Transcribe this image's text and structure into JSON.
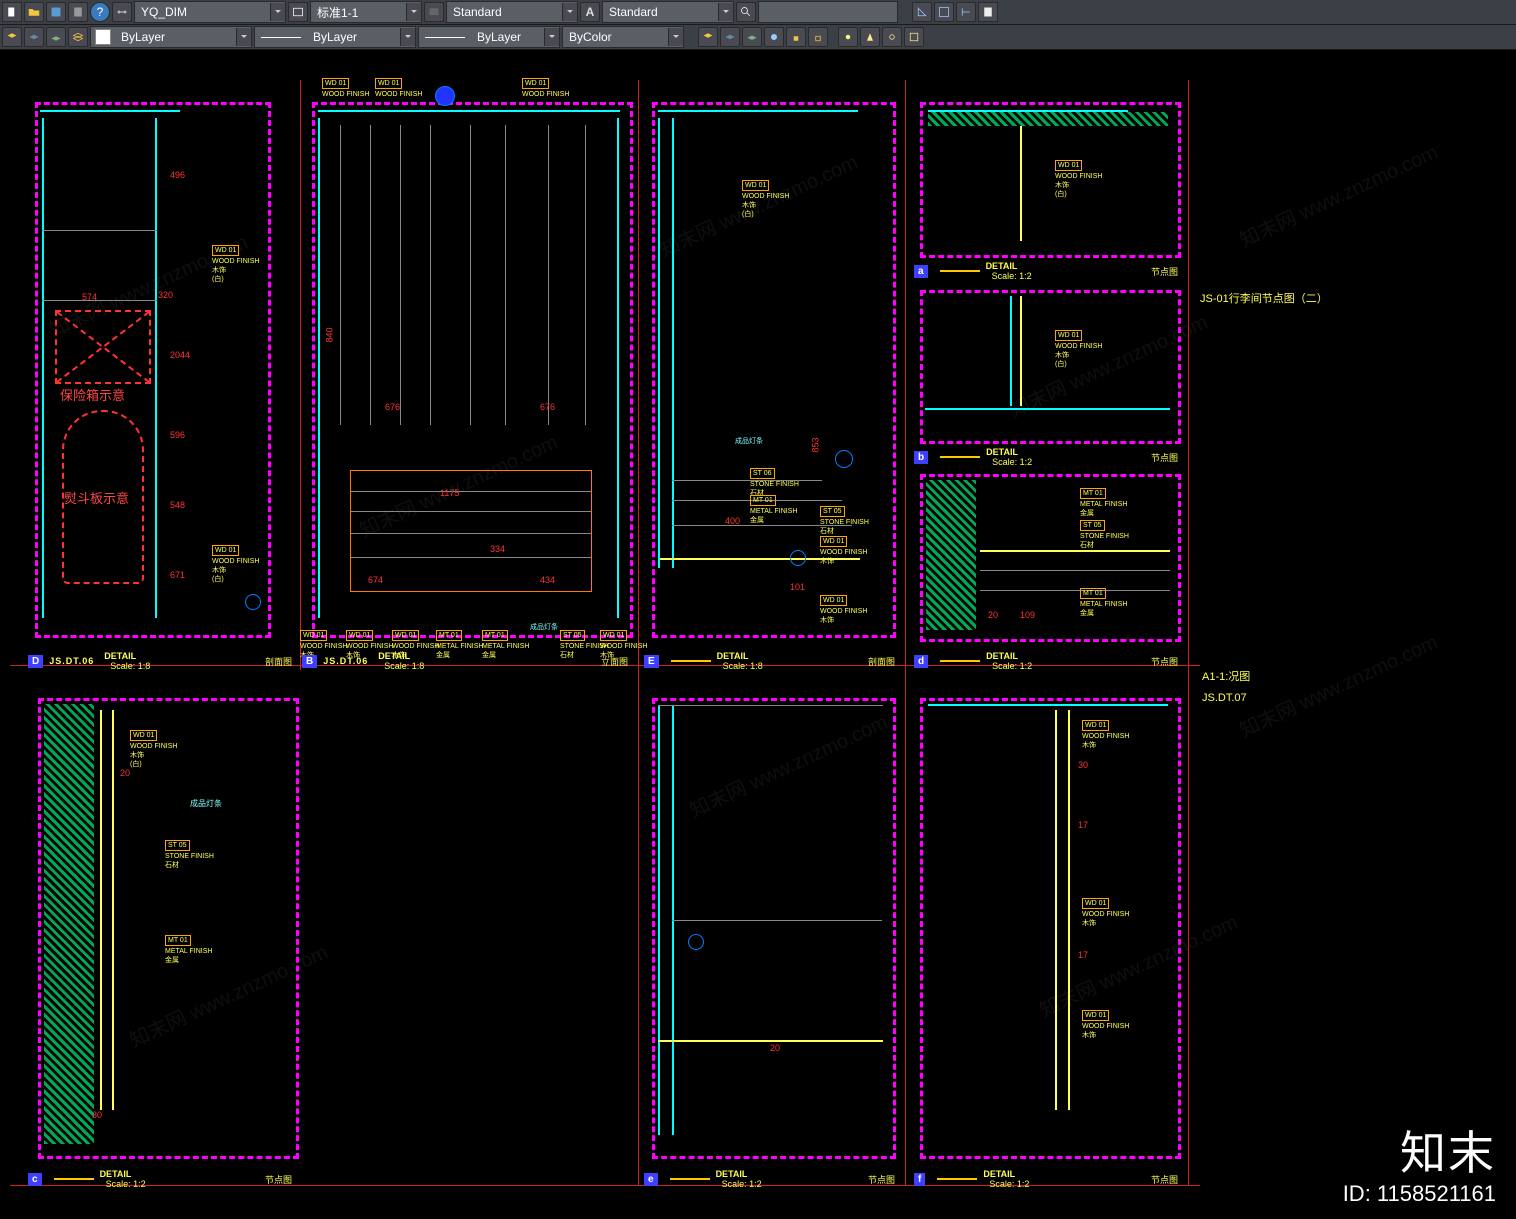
{
  "toolbar1": {
    "dimstyle": "YQ_DIM",
    "tablestyle": "标准1-1",
    "mlstyle": "Standard",
    "textstyle": "Standard",
    "search_placeholder": ""
  },
  "toolbar2": {
    "layer": "ByLayer",
    "linetype": "ByLayer",
    "lineweight": "ByLayer",
    "plotstyle": "ByColor"
  },
  "titleblocks": {
    "D": {
      "tag": "D",
      "code": "JS.DT.06",
      "detail": "DETAIL",
      "scale": "Scale: 1:8",
      "label": "剖面图"
    },
    "B": {
      "tag": "B",
      "code": "JS.DT.06",
      "detail": "DETAIL",
      "scale": "Scale: 1:8",
      "label": "立面图"
    },
    "E": {
      "tag": "E",
      "code": "—",
      "detail": "DETAIL",
      "scale": "Scale: 1:8",
      "label": "剖面图"
    },
    "a": {
      "tag": "a",
      "code": "—",
      "detail": "DETAIL",
      "scale": "Scale: 1:2",
      "label": "节点图"
    },
    "b": {
      "tag": "b",
      "code": "—",
      "detail": "DETAIL",
      "scale": "Scale: 1:2",
      "label": "节点图"
    },
    "d": {
      "tag": "d",
      "code": "—",
      "detail": "DETAIL",
      "scale": "Scale: 1:2",
      "label": "节点图"
    },
    "c": {
      "tag": "c",
      "code": "—",
      "detail": "DETAIL",
      "scale": "Scale: 1:2",
      "label": "节点图"
    },
    "e": {
      "tag": "e",
      "code": "—",
      "detail": "DETAIL",
      "scale": "Scale: 1:2",
      "label": "节点图"
    },
    "f": {
      "tag": "f",
      "code": "—",
      "detail": "DETAIL",
      "scale": "Scale: 1:2",
      "label": "节点图"
    }
  },
  "side": {
    "sheet_title": "JS-01行李间节点图（二）",
    "format": "A1-1:况图",
    "sheetno": "JS.DT.07"
  },
  "drawing": {
    "safe_box": "保险箱示意",
    "iron_board": "熨斗板示意",
    "strip": "成品灯条"
  },
  "callouts": {
    "wd01": {
      "code": "WD 01",
      "mat": "WOOD FINISH",
      "note": "木饰",
      "paint": "(白)"
    },
    "mt01": {
      "code": "MT 01",
      "mat": "METAL FINISH",
      "note": "金属"
    },
    "st05": {
      "code": "ST 05",
      "mat": "STONE FINISH",
      "note": "石材"
    },
    "st06": {
      "code": "ST 06",
      "mat": "STONE FINISH",
      "note": "石材"
    }
  },
  "dims": {
    "d574": "574",
    "d320": "320",
    "d676a": "676",
    "d676b": "676",
    "d1175": "1175",
    "d334": "334",
    "d434": "434",
    "d674": "674",
    "d596": "596",
    "d548": "548",
    "d400": "400",
    "d496": "496",
    "d671": "671",
    "d17": "17",
    "d840": "840",
    "d101": "101",
    "d2044": "2044",
    "d20": "20",
    "d109": "109",
    "d853": "853",
    "d30": "30"
  },
  "watermark": {
    "text": "知末网 www.znzmo.com",
    "logo": "知末",
    "id": "ID: 1158521161"
  }
}
